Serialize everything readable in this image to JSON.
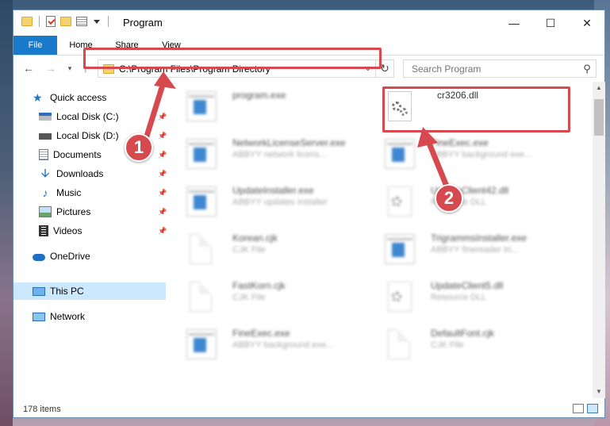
{
  "window": {
    "title": "Program",
    "controls": {
      "minimize": "—",
      "maximize": "☐",
      "close": "✕"
    }
  },
  "ribbon": {
    "tabs": [
      "File",
      "Home",
      "Share",
      "View"
    ]
  },
  "address": {
    "path": "C:\\Program Files\\Program Directory"
  },
  "search": {
    "placeholder": "Search Program"
  },
  "nav": {
    "items": [
      {
        "label": "Quick access"
      },
      {
        "label": "Local Disk (C:)"
      },
      {
        "label": "Local Disk (D:)"
      },
      {
        "label": "Documents"
      },
      {
        "label": "Downloads"
      },
      {
        "label": "Music"
      },
      {
        "label": "Pictures"
      },
      {
        "label": "Videos"
      },
      {
        "label": "OneDrive"
      },
      {
        "label": "This PC"
      },
      {
        "label": "Network"
      }
    ]
  },
  "files": [
    {
      "name": "program.exe",
      "desc": ""
    },
    {
      "name": "cr3206.dll",
      "desc": ""
    },
    {
      "name": "NetworkLicenseServer.exe",
      "desc": "ABBYY network licens..."
    },
    {
      "name": "FineExec.exe",
      "desc": "ABBYY background exe..."
    },
    {
      "name": "UpdateInstaller.exe",
      "desc": "ABBYY updates installer"
    },
    {
      "name": "UpdateClient42.dll",
      "desc": "Resource DLL"
    },
    {
      "name": "Korean.cjk",
      "desc": "CJK File"
    },
    {
      "name": "TrigrammsInstaller.exe",
      "desc": "ABBYY finereader tri..."
    },
    {
      "name": "FastKorn.cjk",
      "desc": "CJK File"
    },
    {
      "name": "UpdateClient5.dll",
      "desc": "Resource DLL"
    },
    {
      "name": "FineExec.exe",
      "desc": "ABBYY background exe..."
    },
    {
      "name": "DefaultFont.cjk",
      "desc": "CJK File"
    }
  ],
  "status": {
    "count": "178 items"
  },
  "steps": {
    "one": "1",
    "two": "2"
  },
  "colors": {
    "highlight": "#d64a4f",
    "file_tab": "#1979ca",
    "selection": "#cce8ff"
  }
}
